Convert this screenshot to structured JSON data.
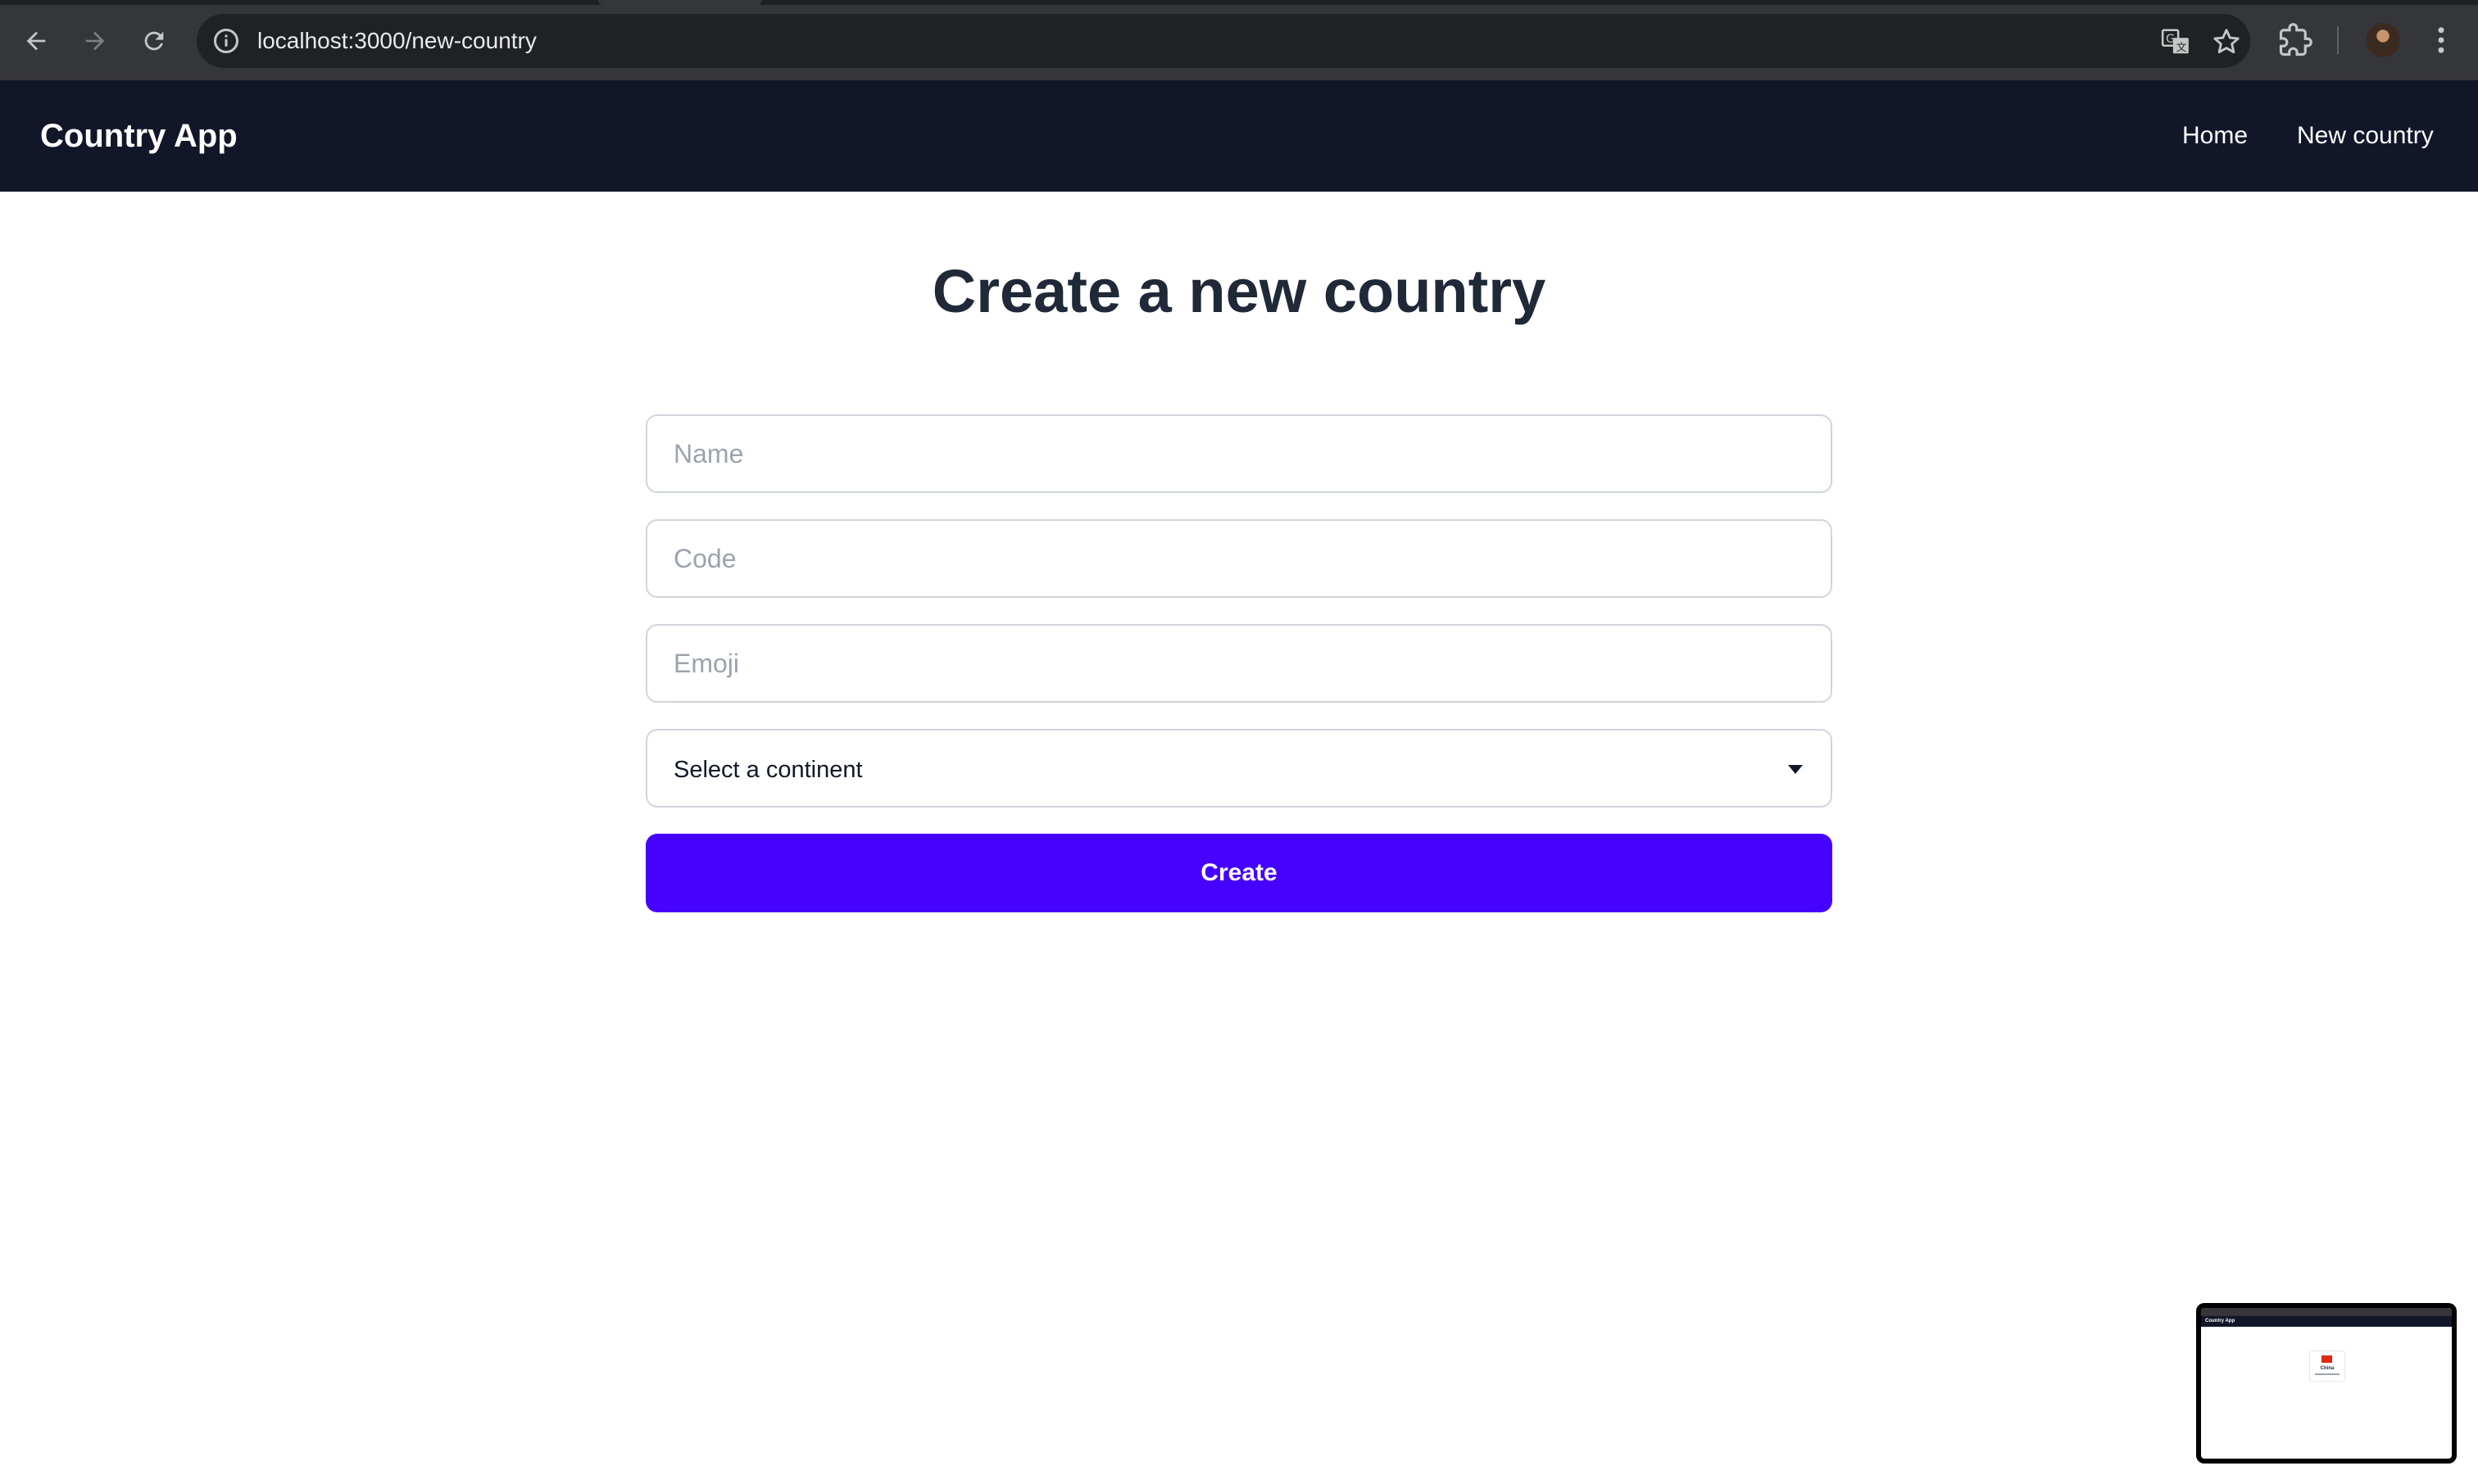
{
  "browser": {
    "url": "localhost:3000/new-country",
    "icons": [
      "back-arrow-icon",
      "forward-arrow-icon",
      "reload-icon",
      "site-info-icon",
      "translate-icon",
      "bookmark-star-icon",
      "extensions-icon",
      "profile-avatar",
      "more-menu-icon"
    ]
  },
  "navbar": {
    "brand": "Country App",
    "links": [
      {
        "label": "Home"
      },
      {
        "label": "New country"
      }
    ]
  },
  "page": {
    "title": "Create a new country"
  },
  "form": {
    "name": {
      "placeholder": "Name",
      "value": ""
    },
    "code": {
      "placeholder": "Code",
      "value": ""
    },
    "emoji": {
      "placeholder": "Emoji",
      "value": ""
    },
    "continent": {
      "selected": "Select a continent"
    },
    "submit_label": "Create"
  },
  "thumbnail": {
    "brand": "Country App",
    "card_name": "China"
  },
  "colors": {
    "navbar_bg": "#111729",
    "primary_button": "#4503ff",
    "title_text": "#1f2937",
    "input_border": "#d1d5db"
  }
}
